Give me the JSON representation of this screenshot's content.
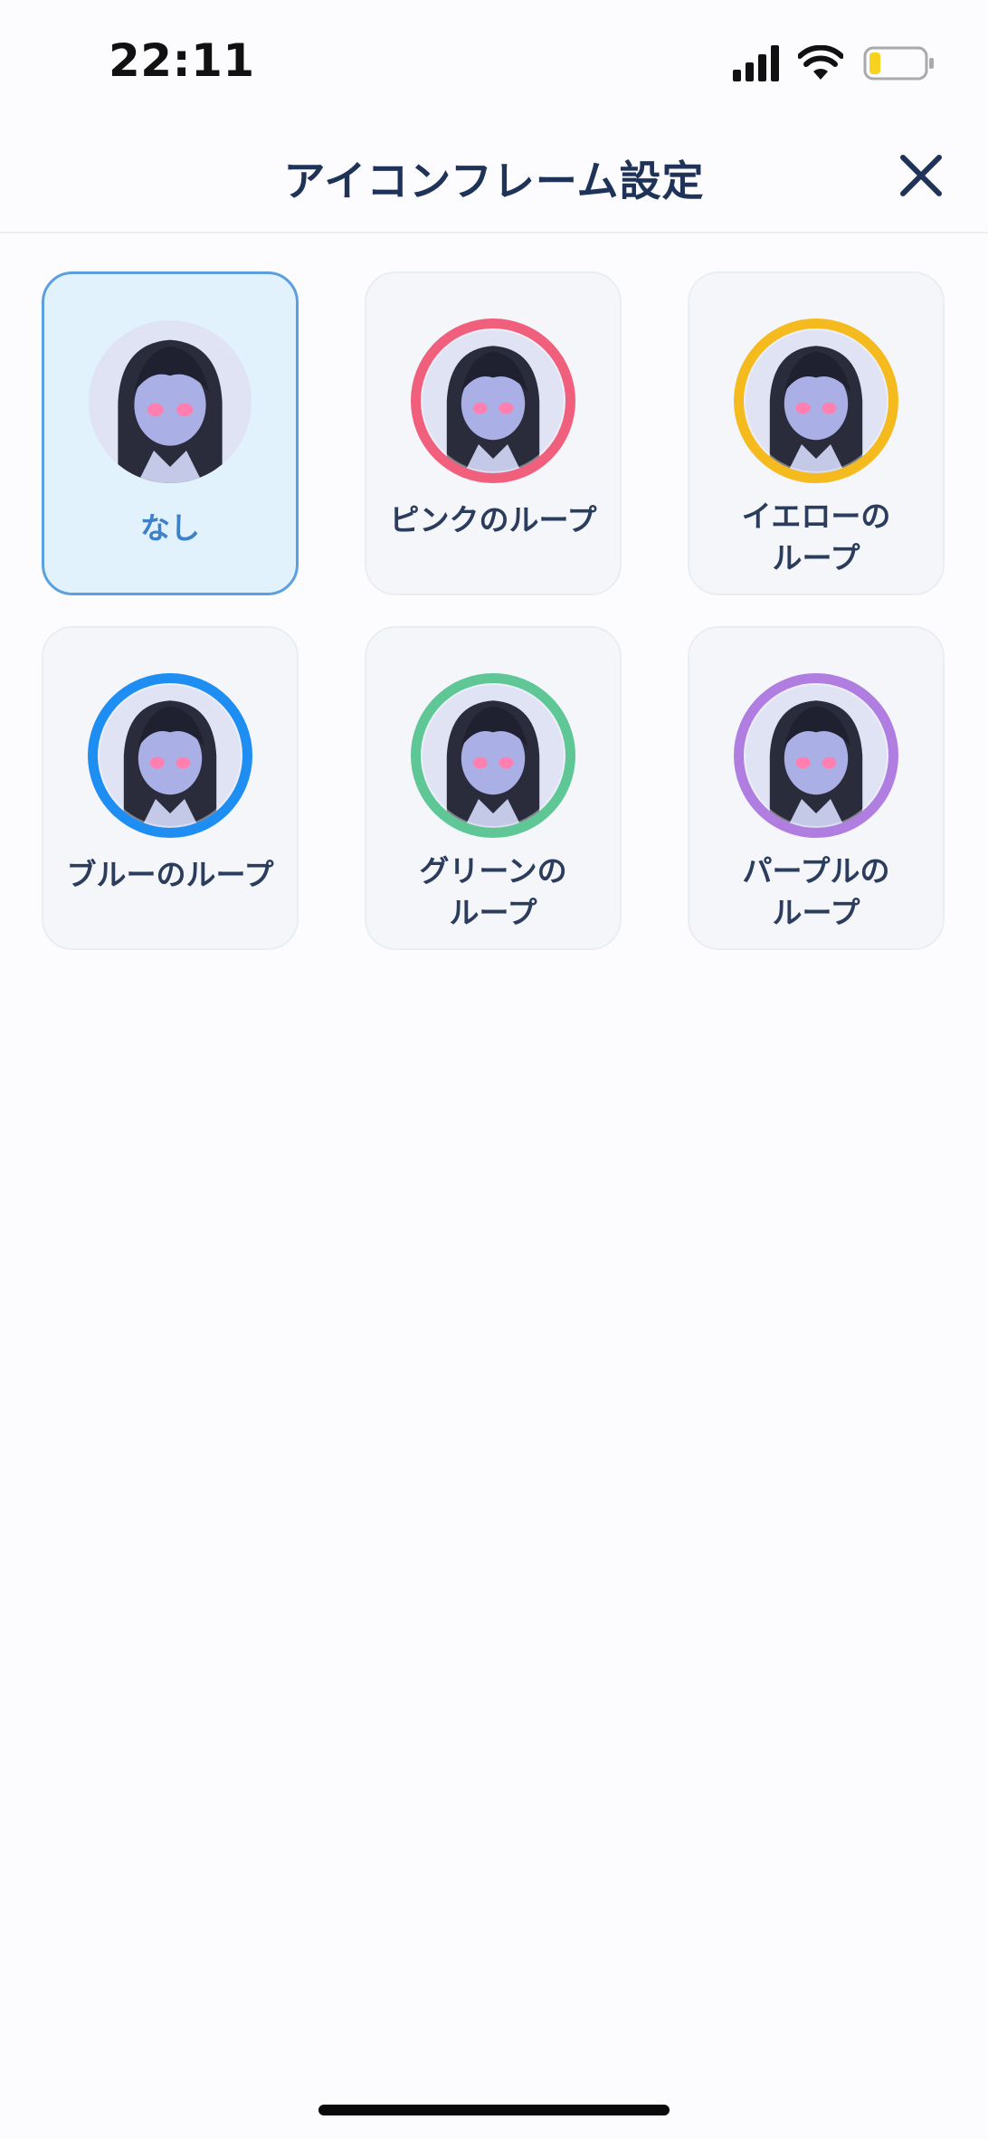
{
  "status": {
    "time": "22:11"
  },
  "header": {
    "title": "アイコンフレーム設定"
  },
  "frames": [
    {
      "label": "なし",
      "ring_color": "",
      "selected": true
    },
    {
      "label": "ピンクのループ",
      "ring_color": "#f0607c",
      "selected": false
    },
    {
      "label": "イエローのループ",
      "line1": "イエローの",
      "line2": "ループ",
      "ring_color": "#f5bb1e",
      "selected": false
    },
    {
      "label": "ブルーのループ",
      "ring_color": "#1f8ef2",
      "selected": false
    },
    {
      "label": "グリーンのループ",
      "line1": "グリーンの",
      "line2": "ループ",
      "ring_color": "#5ec795",
      "selected": false
    },
    {
      "label": "パープルのループ",
      "line1": "パープルの",
      "line2": "ループ",
      "ring_color": "#b07ee0",
      "selected": false
    }
  ],
  "colors": {
    "title": "#1f3358",
    "selected_label": "#3d82c8",
    "selected_bg": "#e2f2fd",
    "selected_border": "#5b9fe0",
    "battery": "#f7d21e"
  },
  "icons": [
    "signal-icon",
    "wifi-icon",
    "battery-icon",
    "close-icon"
  ]
}
